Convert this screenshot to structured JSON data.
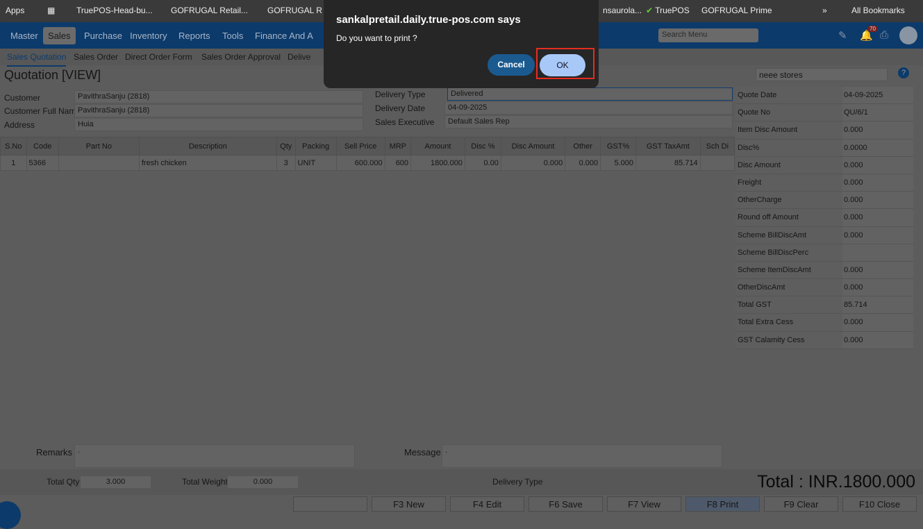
{
  "bookmarks": {
    "items": [
      "Apps",
      "TruePOS-Head-bu...",
      "GOFRUGAL Retail...",
      "GOFRUGAL R",
      "nsaurola...",
      "TruePOS",
      "GOFRUGAL Prime"
    ],
    "all": "All Bookmarks"
  },
  "nav": {
    "items": [
      "Master",
      "Sales",
      "Purchase",
      "Inventory",
      "Reports",
      "Tools",
      "Finance And A"
    ],
    "search_placeholder": "Search Menu",
    "notifications": "70"
  },
  "subnav": [
    "Sales Quotation",
    "Sales Order",
    "Direct Order Form",
    "Sales Order Approval",
    "Delive"
  ],
  "page": {
    "title": "Quotation [VIEW]",
    "store": "neee stores"
  },
  "form": {
    "customer_label": "Customer",
    "customer": "PavithraSanju (2818)",
    "full_name_label": "Customer Full Name",
    "full_name": "PavithraSanju (2818)",
    "address_label": "Address",
    "address": "Huia",
    "delivery_type_label": "Delivery Type",
    "delivery_type": "Delivered",
    "delivery_date_label": "Delivery Date",
    "delivery_date": "04-09-2025",
    "exec_label": "Sales Executive",
    "exec": "Default Sales Rep"
  },
  "table": {
    "headers": [
      "S.No",
      "Code",
      "Part No",
      "Description",
      "Qty",
      "Packing",
      "Sell Price",
      "MRP",
      "Amount",
      "Disc %",
      "Disc Amount",
      "Other",
      "GST%",
      "GST TaxAmt",
      "Sch Di"
    ],
    "rows": [
      [
        "1",
        "5366",
        "",
        "fresh chicken",
        "3",
        "UNIT",
        "600.000",
        "600",
        "1800.000",
        "0.00",
        "0.000",
        "0.000",
        "5.000",
        "85.714",
        ""
      ]
    ]
  },
  "summary": [
    [
      "Quote Date",
      "04-09-2025"
    ],
    [
      "Quote No",
      "QU/6/1"
    ],
    [
      "Item Disc Amount",
      "0.000"
    ],
    [
      "Disc%",
      "0.0000"
    ],
    [
      "Disc Amount",
      "0.000"
    ],
    [
      "Freight",
      "0.000"
    ],
    [
      "OtherCharge",
      "0.000"
    ],
    [
      "Round off Amount",
      "0.000"
    ],
    [
      "Scheme BillDiscAmt",
      "0.000"
    ],
    [
      "Scheme BillDiscPerc",
      ""
    ],
    [
      "Scheme ItemDiscAmt",
      "0.000"
    ],
    [
      "OtherDiscAmt",
      "0.000"
    ],
    [
      "Total GST",
      "85.714"
    ],
    [
      "Total Extra Cess",
      "0.000"
    ],
    [
      "GST Calamity Cess",
      "0.000"
    ]
  ],
  "footer": {
    "remarks_label": "Remarks",
    "remarks": ".",
    "message_label": "Message",
    "message": ".",
    "total_qty_label": "Total Qty",
    "total_qty": "3.000",
    "total_weight_label": "Total Weight",
    "total_weight": "0.000",
    "delivery_type_label": "Delivery Type",
    "total": "Total : INR.1800.000"
  },
  "buttons": [
    "",
    "F3 New",
    "F4 Edit",
    "F6 Save",
    "F7 View",
    "F8 Print",
    "F9 Clear",
    "F10 Close"
  ],
  "dialog": {
    "title": "sankalpretail.daily.true-pos.com says",
    "message": "Do you want to print ?",
    "cancel": "Cancel",
    "ok": "OK"
  }
}
